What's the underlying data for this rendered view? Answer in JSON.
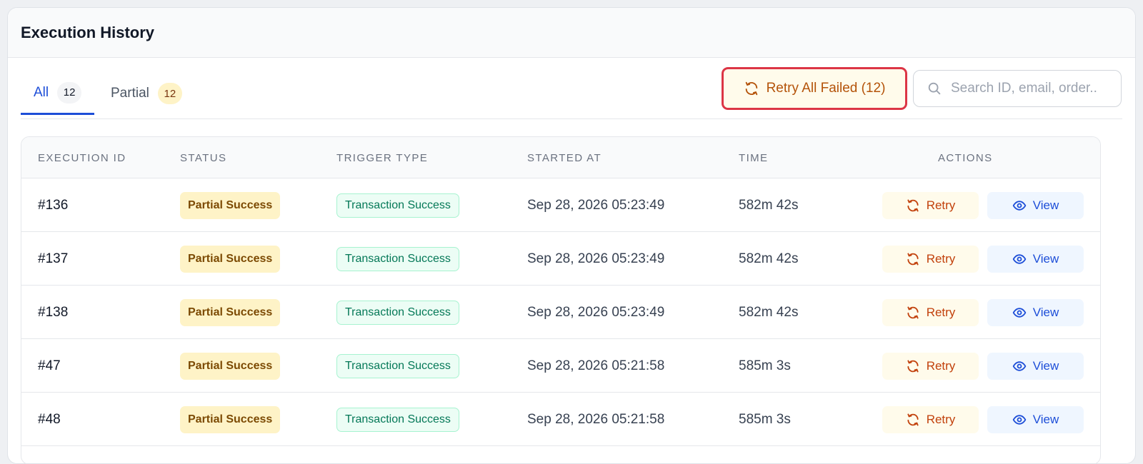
{
  "panel": {
    "title": "Execution History"
  },
  "tabs": [
    {
      "label": "All",
      "count": "12"
    },
    {
      "label": "Partial",
      "count": "12"
    }
  ],
  "toolbar": {
    "retry_all_label": "Retry All Failed (12)",
    "search_placeholder": "Search ID, email, order..",
    "search_value": ""
  },
  "table": {
    "columns": [
      "EXECUTION ID",
      "STATUS",
      "TRIGGER TYPE",
      "STARTED AT",
      "TIME",
      "ACTIONS"
    ],
    "retry_label": "Retry",
    "view_label": "View",
    "rows": [
      {
        "id": "#136",
        "status": "Partial Success",
        "trigger": "Transaction Success",
        "started": "Sep 28, 2026 05:23:49",
        "time": "582m 42s"
      },
      {
        "id": "#137",
        "status": "Partial Success",
        "trigger": "Transaction Success",
        "started": "Sep 28, 2026 05:23:49",
        "time": "582m 42s"
      },
      {
        "id": "#138",
        "status": "Partial Success",
        "trigger": "Transaction Success",
        "started": "Sep 28, 2026 05:23:49",
        "time": "582m 42s"
      },
      {
        "id": "#47",
        "status": "Partial Success",
        "trigger": "Transaction Success",
        "started": "Sep 28, 2026 05:21:58",
        "time": "585m 3s"
      },
      {
        "id": "#48",
        "status": "Partial Success",
        "trigger": "Transaction Success",
        "started": "Sep 28, 2026 05:21:58",
        "time": "585m 3s"
      }
    ]
  },
  "icons": {
    "retry_all": "refresh-icon",
    "search": "search-icon",
    "retry": "retry-icon",
    "view": "eye-icon"
  },
  "colors": {
    "accent": "#1d4ed8",
    "warning_bg": "#fef3c7",
    "warning_text": "#b45309",
    "success_bg": "#ecfdf5",
    "success_text": "#047857",
    "highlight_border": "#dc3545"
  }
}
